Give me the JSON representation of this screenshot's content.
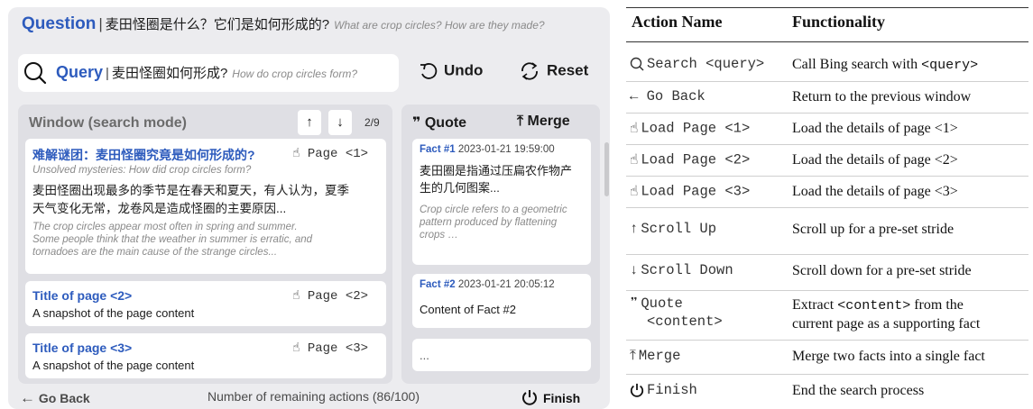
{
  "question": {
    "label": "Question",
    "zh": "麦田怪圈是什么？它们是如何形成的?",
    "en": "What are crop circles? How are they made?"
  },
  "query": {
    "label": "Query",
    "zh": "麦田怪圈如何形成?",
    "en": "How do crop circles form?"
  },
  "toolbar": {
    "undo": "Undo",
    "reset": "Reset"
  },
  "window": {
    "title": "Window (search mode)",
    "up_arrow": "↑",
    "down_arrow": "↓",
    "page_count": "2/9",
    "cards": [
      {
        "title_zh": "难解谜团：麦田怪圈究竟是如何形成的?",
        "title_en": "Unsolved mysteries: How did crop circles form?",
        "page_btn": "Page <1>",
        "body_zh_1": "麦田怪圈出现最多的季节是在春天和夏天，有人认为，夏季",
        "body_zh_2": "天气变化无常，龙卷风是造成怪圈的主要原因...",
        "body_en_1": "The crop circles appear most often in spring and summer.",
        "body_en_2": "Some people think that the weather in summer is erratic, and",
        "body_en_3": "tornadoes are the main cause of the strange circles..."
      },
      {
        "title": "Title of page <2>",
        "snapshot": "A snapshot of the page content",
        "page_btn": "Page <2>"
      },
      {
        "title": "Title of page <3>",
        "snapshot": "A snapshot of the page content",
        "page_btn": "Page <3>"
      }
    ]
  },
  "facts_panel": {
    "quote_label": "Quote",
    "merge_label": "Merge",
    "facts": [
      {
        "id": "Fact #1",
        "timestamp": "2023-01-21 19:59:00",
        "zh_1": "麦田圈是指通过压扁农作物产",
        "zh_2": "生的几何图案...",
        "en_1": "Crop circle refers to a geometric",
        "en_2": "pattern produced by flattening",
        "en_3": "crops …"
      },
      {
        "id": "Fact #2",
        "timestamp": "2023-01-21 20:05:12",
        "content": "Content of Fact #2"
      },
      {
        "content": "..."
      }
    ]
  },
  "bottom_bar": {
    "go_back": "Go Back",
    "remaining": "Number of remaining actions (86/100)",
    "finish": "Finish"
  },
  "action_table": {
    "headers": {
      "name": "Action Name",
      "func": "Functionality"
    },
    "rows": [
      {
        "icon": "search-icon",
        "name": "Search <query>",
        "func_pre": "Call Bing search with ",
        "func_mono": "<query>"
      },
      {
        "icon": "left-arrow-icon",
        "name": "← Go Back",
        "func_pre": "Return to the previous window"
      },
      {
        "icon": "hand-pointer-icon",
        "name": "Load Page <1>",
        "func_pre": "Load the details of  page <1>"
      },
      {
        "icon": "hand-pointer-icon",
        "name": "Load Page <2>",
        "func_pre": "Load the details of  page <2>"
      },
      {
        "icon": "hand-pointer-icon",
        "name": "Load Page <3>",
        "func_pre": "Load the details of  page <3>"
      },
      {
        "icon": "up-arrow-icon",
        "name": "Scroll Up",
        "func_pre": "Scroll up for a pre-set stride"
      },
      {
        "icon": "down-arrow-icon",
        "name": "Scroll Down",
        "func_pre": "Scroll down for a pre-set stride"
      },
      {
        "icon": "quote-icon",
        "name_1": "Quote",
        "name_2": "<content>",
        "func_1a": "Extract ",
        "func_1b": "<content>",
        "func_1c": " from the",
        "func_2": "current page as a supporting fact"
      },
      {
        "icon": "merge-icon",
        "name": "Merge",
        "func_pre": "Merge two facts into a single fact"
      },
      {
        "icon": "power-icon",
        "name": "Finish",
        "func_pre": "End the search process"
      }
    ]
  },
  "colors": {
    "accent": "#2d5bbd",
    "panel_bg": "#ececef",
    "window_bg": "#dfdfe4"
  }
}
